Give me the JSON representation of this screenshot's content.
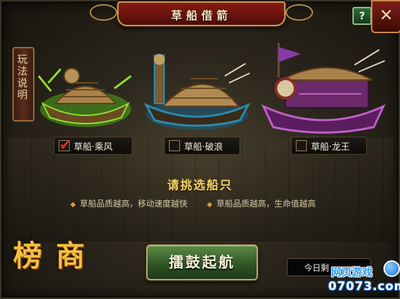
{
  "window": {
    "title": "草船借箭",
    "help_label": "?",
    "close_label": "✕"
  },
  "side_tab": {
    "label": "玩法说明"
  },
  "boats": [
    {
      "label": "草船·乘风",
      "selected": true,
      "highlight": "#8ee030"
    },
    {
      "label": "草船·破浪",
      "selected": false,
      "highlight": "#2a8ab0"
    },
    {
      "label": "草船·龙王",
      "selected": false,
      "highlight": "#9a3aa8"
    }
  ],
  "prompt": "请挑选船只",
  "hints": [
    "草船品质越高，移动速度越快",
    "草船品质越高，生命值越高"
  ],
  "rank_char": "榜",
  "shop_char": "商",
  "sail_button": "擂鼓起航",
  "today_label": "今日剩",
  "watermark": {
    "top": "网页游戏",
    "bottom": "07073.com"
  },
  "colors": {
    "accent": "#f2d46a",
    "button_green": "#2d5223",
    "title_red": "#8a1a14"
  }
}
